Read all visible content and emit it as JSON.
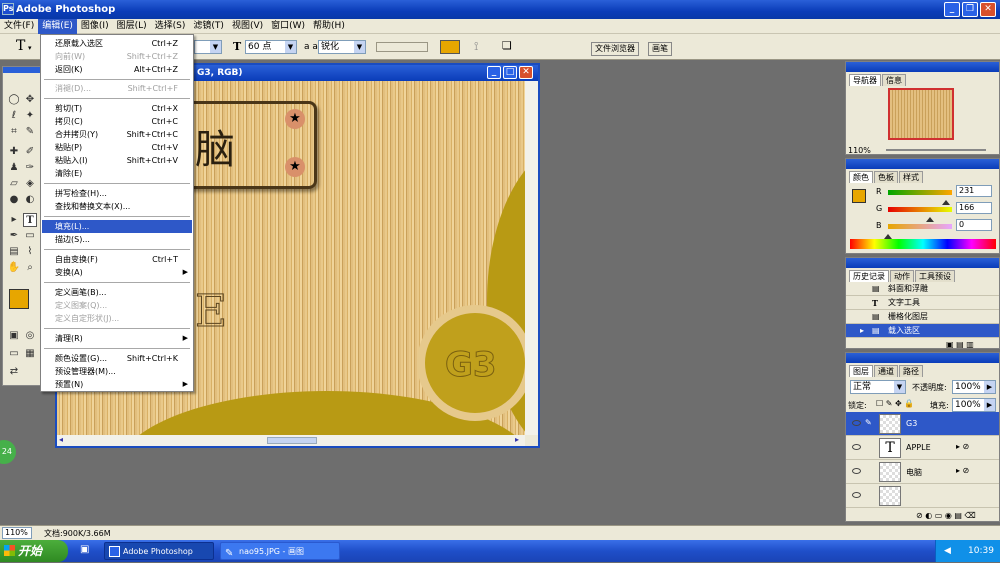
{
  "app": {
    "title": "Adobe Photoshop"
  },
  "menubar": [
    "文件(F)",
    "编辑(E)",
    "图像(I)",
    "图层(L)",
    "选择(S)",
    "滤镜(T)",
    "视图(V)",
    "窗口(W)",
    "帮助(H)"
  ],
  "options": {
    "tool_glyph": "T",
    "size_icon": "T",
    "font_size": "60 点",
    "aa_icon": "a a",
    "aa_mode": "锐化",
    "tab_file_browser": "文件浏览器",
    "tab_brushes": "画笔"
  },
  "edit_menu": [
    {
      "label": "还原载入选区",
      "shortcut": "Ctrl+Z",
      "disabled": false
    },
    {
      "label": "向前(W)",
      "shortcut": "Shift+Ctrl+Z",
      "disabled": true
    },
    {
      "label": "返回(K)",
      "shortcut": "Alt+Ctrl+Z",
      "disabled": false
    },
    {
      "label": "消褪(D)...",
      "shortcut": "Shift+Ctrl+F",
      "disabled": true
    },
    {
      "label": "剪切(T)",
      "shortcut": "Ctrl+X",
      "disabled": false
    },
    {
      "label": "拷贝(C)",
      "shortcut": "Ctrl+C",
      "disabled": false
    },
    {
      "label": "合并拷贝(Y)",
      "shortcut": "Shift+Ctrl+C",
      "disabled": false
    },
    {
      "label": "粘贴(P)",
      "shortcut": "Ctrl+V",
      "disabled": false
    },
    {
      "label": "粘贴入(I)",
      "shortcut": "Shift+Ctrl+V",
      "disabled": false
    },
    {
      "label": "清除(E)",
      "shortcut": "",
      "disabled": false
    },
    {
      "label": "拼写检查(H)...",
      "shortcut": "",
      "disabled": false
    },
    {
      "label": "查找和替换文本(X)...",
      "shortcut": "",
      "disabled": false
    },
    {
      "label": "填充(L)...",
      "shortcut": "",
      "disabled": false,
      "highlighted": true
    },
    {
      "label": "描边(S)...",
      "shortcut": "",
      "disabled": false
    },
    {
      "label": "自由变换(F)",
      "shortcut": "Ctrl+T",
      "disabled": false
    },
    {
      "label": "变换(A)",
      "shortcut": "",
      "disabled": false,
      "submenu": true
    },
    {
      "label": "定义画笔(B)...",
      "shortcut": "",
      "disabled": false
    },
    {
      "label": "定义图案(Q)...",
      "shortcut": "",
      "disabled": true
    },
    {
      "label": "定义自定形状(J)...",
      "shortcut": "",
      "disabled": true
    },
    {
      "label": "清理(R)",
      "shortcut": "",
      "disabled": false,
      "submenu": true
    },
    {
      "label": "颜色设置(G)...",
      "shortcut": "Shift+Ctrl+K",
      "disabled": false
    },
    {
      "label": "预设管理器(M)...",
      "shortcut": "",
      "disabled": false
    },
    {
      "label": "预置(N)",
      "shortcut": "",
      "disabled": false,
      "submenu": true
    }
  ],
  "document": {
    "title": "G3, RGB)",
    "text_fragment": "脑",
    "text_e": "E",
    "text_g3": "G3"
  },
  "navigator": {
    "tabs": [
      "导航器",
      "信息"
    ],
    "zoom": "110%"
  },
  "color": {
    "tabs": [
      "颜色",
      "色板",
      "样式"
    ],
    "r_label": "R",
    "g_label": "G",
    "b_label": "B",
    "r": "231",
    "g": "166",
    "b": "0",
    "r_level": 0.906,
    "g_level": 0.651,
    "b_level": 0.0,
    "swatch": "#e7a600"
  },
  "history": {
    "tabs": [
      "历史记录",
      "动作",
      "工具预设"
    ],
    "items": [
      "斜面和浮雕",
      "文字工具",
      "栅格化图层",
      "载入选区"
    ]
  },
  "layers": {
    "tabs": [
      "图层",
      "通道",
      "路径"
    ],
    "blend": "正常",
    "opacity_label": "不透明度:",
    "opacity": "100%",
    "lock_label": "锁定:",
    "fill_label": "填充:",
    "fill": "100%",
    "items": [
      "G3",
      "APPLE",
      "电脑"
    ]
  },
  "status": {
    "zoom": "110%",
    "doc": "文档:900K/3.66M"
  },
  "taskbar": {
    "start": "开始",
    "tasks": [
      "Adobe Photoshop",
      "nao95.JPG - 画图"
    ],
    "time": "10:39",
    "badge": "24"
  }
}
